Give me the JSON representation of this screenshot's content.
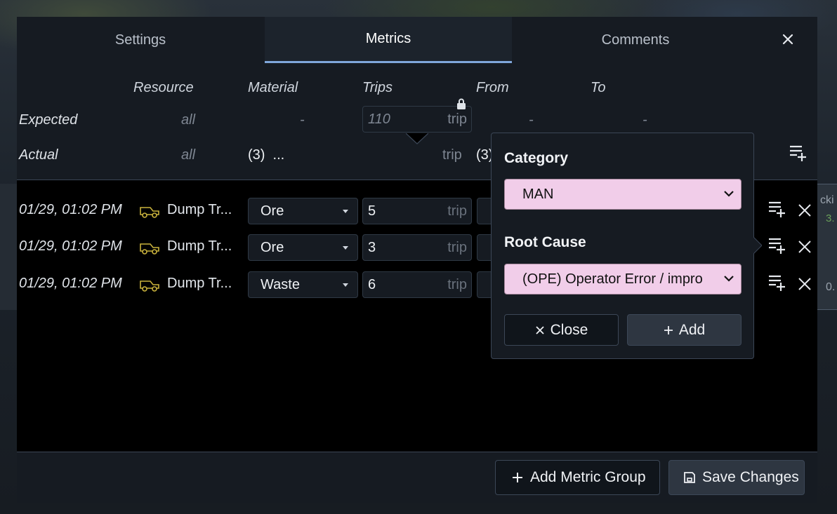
{
  "tabs": {
    "settings": "Settings",
    "metrics": "Metrics",
    "comments": "Comments"
  },
  "summary": {
    "columns": {
      "resource": "Resource",
      "material": "Material",
      "trips": "Trips",
      "from": "From",
      "to": "To"
    },
    "expected": {
      "label": "Expected",
      "resource": "all",
      "material": "-",
      "trips_value": "110",
      "trips_unit": "trip",
      "from": "-",
      "to": "-"
    },
    "actual": {
      "label": "Actual",
      "resource": "all",
      "material": "(3)  ...",
      "trips_unit": "trip",
      "from": "(3)"
    }
  },
  "rows": [
    {
      "timestamp": "01/29, 01:02 PM",
      "resource": "Dump Tr...",
      "material": "Ore",
      "trips": "5",
      "unit": "trip"
    },
    {
      "timestamp": "01/29, 01:02 PM",
      "resource": "Dump Tr...",
      "material": "Ore",
      "trips": "3",
      "unit": "trip"
    },
    {
      "timestamp": "01/29, 01:02 PM",
      "resource": "Dump Tr...",
      "material": "Waste",
      "trips": "6",
      "unit": "trip"
    }
  ],
  "popover": {
    "category_label": "Category",
    "category_value": "MAN",
    "root_cause_label": "Root Cause",
    "root_cause_value": "(OPE) Operator Error / impro",
    "close_label": "Close",
    "add_label": "Add"
  },
  "footer": {
    "add_metric_group": "Add Metric Group",
    "save_changes": "Save Changes"
  },
  "background": {
    "frag_right": "cki",
    "frag_right2": "3.",
    "frag_right3": "0."
  },
  "colors": {
    "accent": "#7fa7db",
    "highlight_select": "#f1cde9",
    "truck_icon": "#c9b23c"
  }
}
